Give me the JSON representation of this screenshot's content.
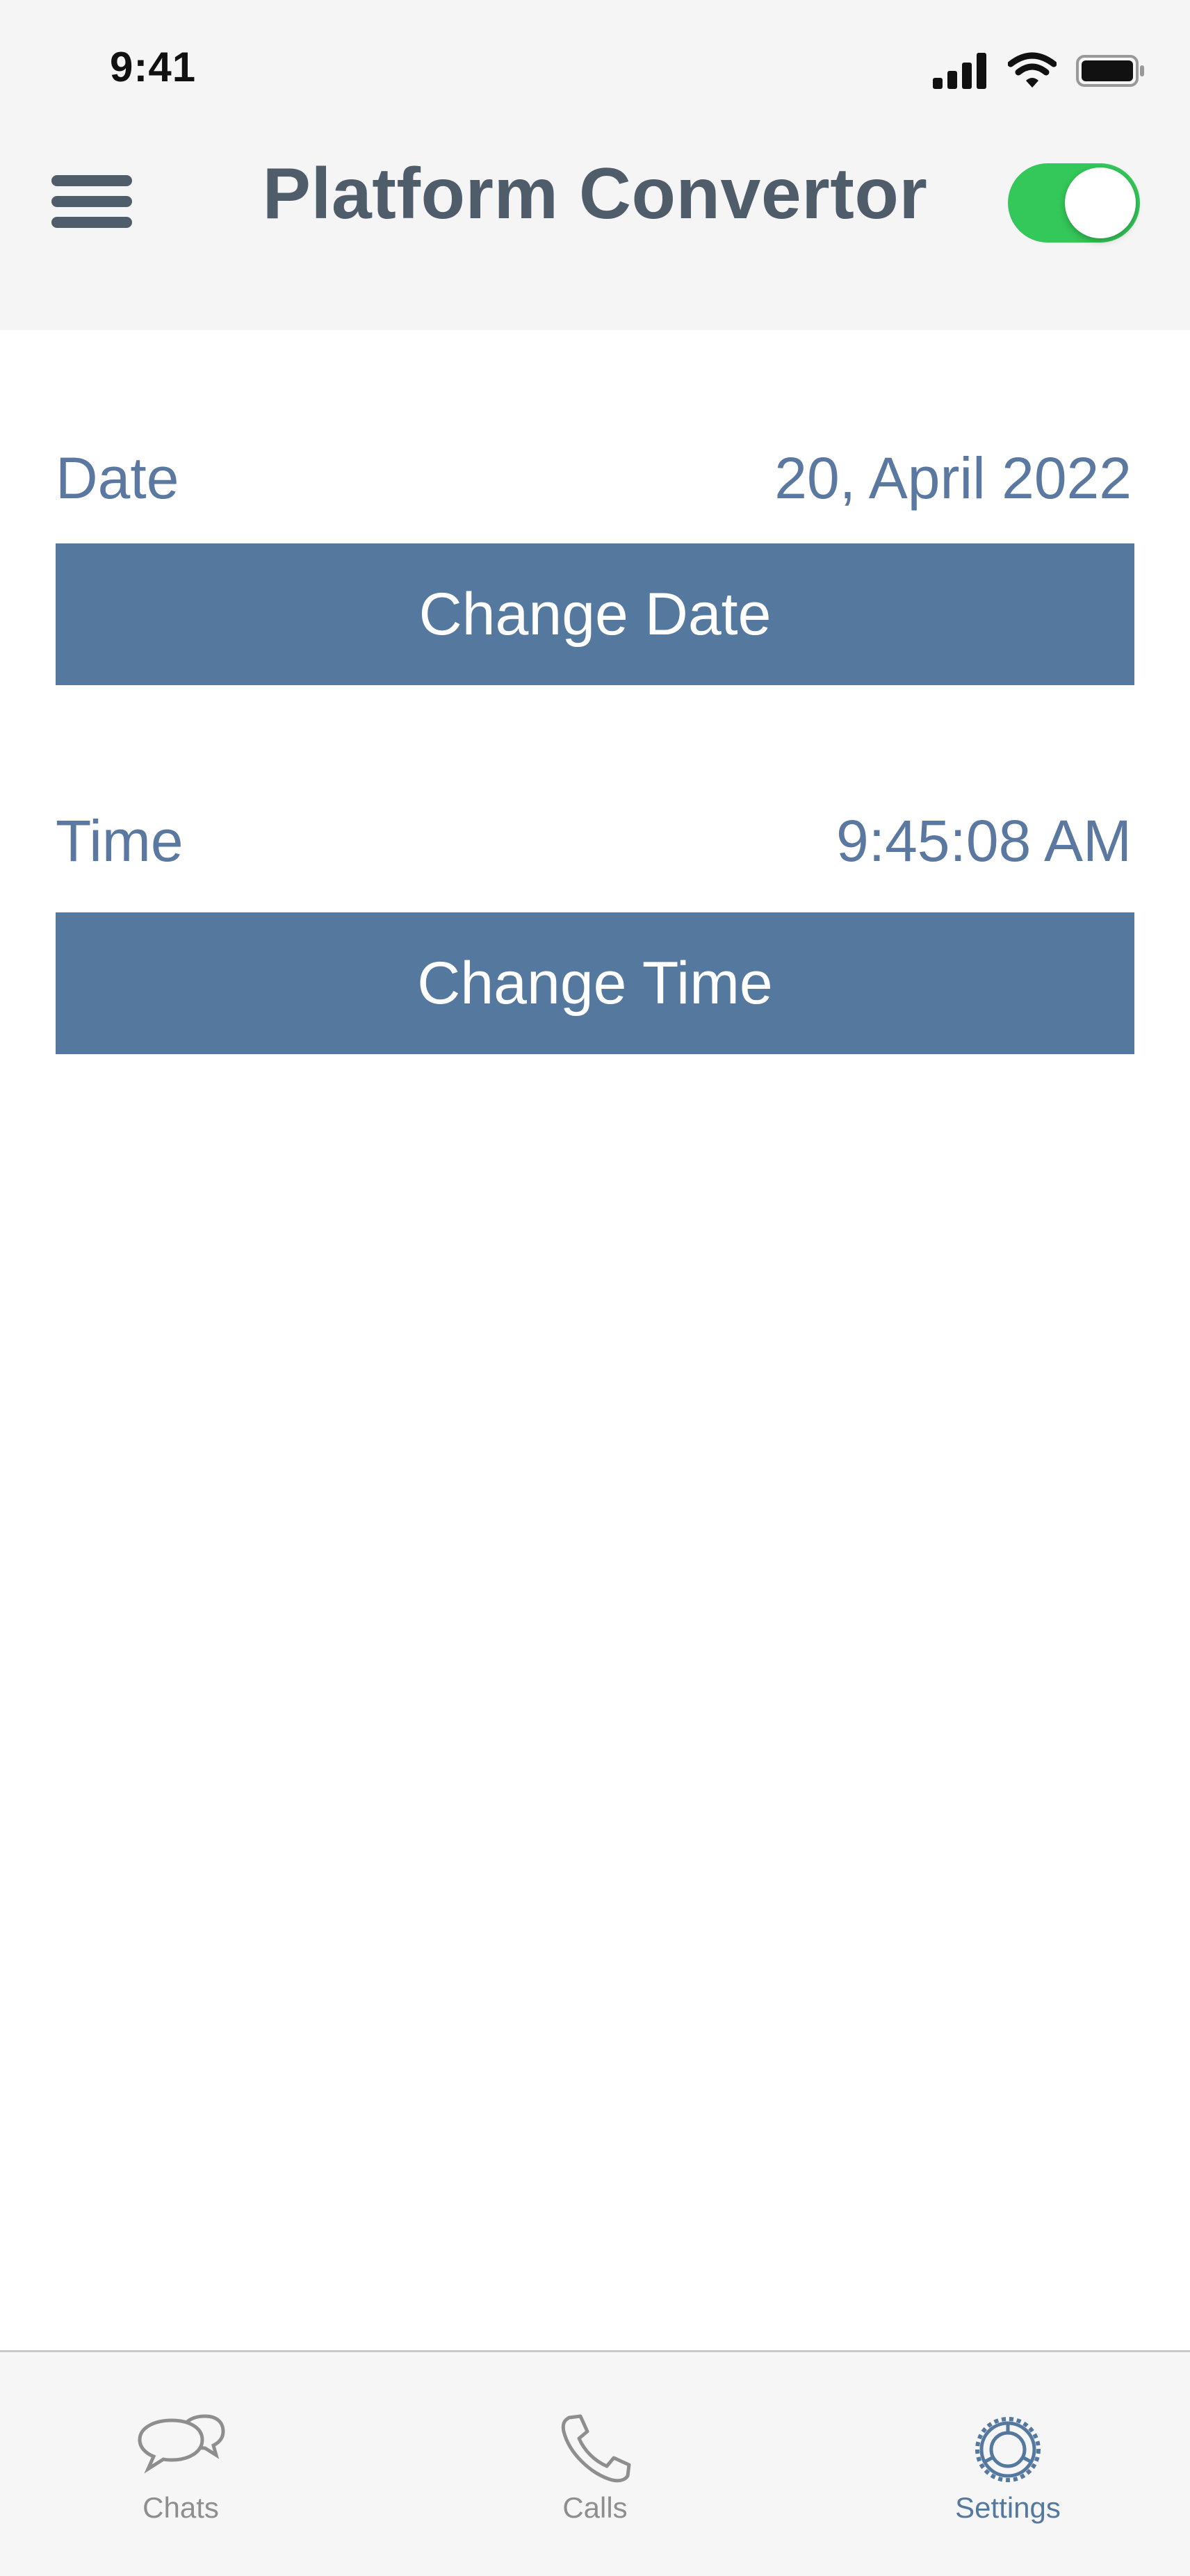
{
  "status_bar": {
    "time": "9:41"
  },
  "nav": {
    "title": "Platform Convertor",
    "toggle_on": true
  },
  "date_row": {
    "label": "Date",
    "value": "20, April 2022",
    "button_label": "Change Date"
  },
  "time_row": {
    "label": "Time",
    "value": "9:45:08 AM",
    "button_label": "Change Time"
  },
  "tabbar": {
    "tabs": [
      {
        "label": "Chats",
        "icon": "chat-bubbles-icon",
        "active": false
      },
      {
        "label": "Calls",
        "icon": "phone-icon",
        "active": false
      },
      {
        "label": "Settings",
        "icon": "settings-gear-icon",
        "active": true
      }
    ]
  },
  "colors": {
    "accent": "#55789f",
    "toggle_on": "#34c759",
    "title": "#4f5c6a",
    "inactive_tab": "#8e8e8e"
  }
}
